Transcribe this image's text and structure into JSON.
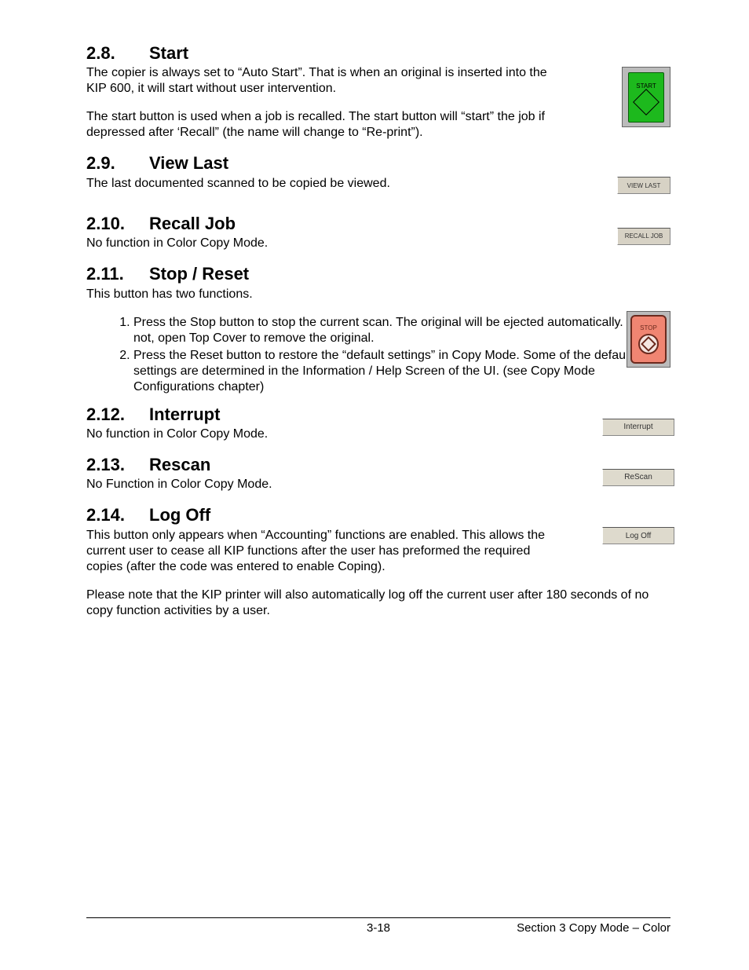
{
  "sections": {
    "s28": {
      "num": "2.8.",
      "title": "Start",
      "p1": "The copier is always set to “Auto Start”. That is when an original is inserted into the KIP 600, it will start without user intervention.",
      "p2": "The start button is used when a job is recalled. The start button will “start” the job if depressed after ‘Recall” (the name will change to “Re-print”).",
      "btn": "START"
    },
    "s29": {
      "num": "2.9.",
      "title": "View Last",
      "p1": "The last documented scanned to be copied be viewed.",
      "btn": "VIEW LAST"
    },
    "s210": {
      "num": "2.10.",
      "title": "Recall Job",
      "p1": "No function in Color Copy Mode.",
      "btn": "RECALL JOB"
    },
    "s211": {
      "num": "2.11.",
      "title": "Stop / Reset",
      "p1": "This button has two functions.",
      "li1": "Press the Stop button to stop the current scan. The original will be ejected automatically. If not, open Top Cover to remove the original.",
      "li2": "Press the Reset button to restore the “default settings” in Copy Mode. Some of the default settings are determined in the Information / Help Screen of the UI. (see Copy Mode Configurations chapter)",
      "btn": "STOP"
    },
    "s212": {
      "num": "2.12.",
      "title": "Interrupt",
      "p1": "No function in Color Copy Mode.",
      "btn": "Interrupt"
    },
    "s213": {
      "num": "2.13.",
      "title": "Rescan",
      "p1": "No Function in Color Copy Mode.",
      "btn": "ReScan"
    },
    "s214": {
      "num": "2.14.",
      "title": "Log Off",
      "p1": "This button only appears when “Accounting” functions are enabled. This allows the current user to cease all KIP functions after the user has preformed the required copies (after the code was entered to enable Coping).",
      "p2": "Please note that the KIP printer will also automatically log off the current user after 180 seconds of no copy function activities by a user.",
      "btn": "Log Off"
    }
  },
  "footer": {
    "page": "3-18",
    "section": "Section 3    Copy Mode – Color"
  }
}
